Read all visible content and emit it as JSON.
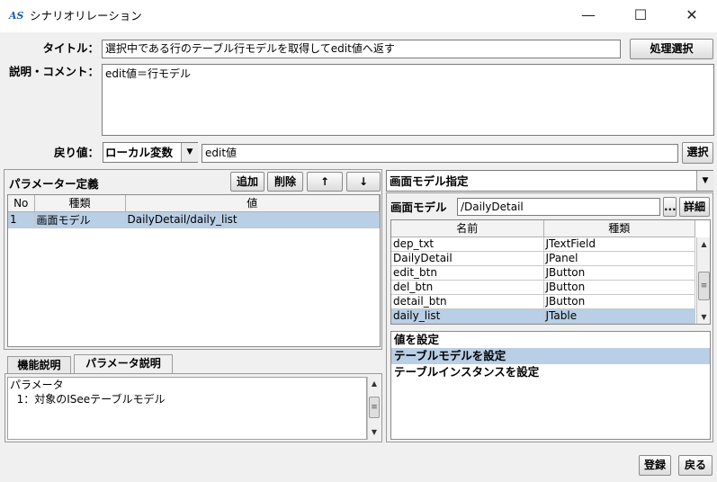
{
  "window": {
    "title": "シナリオリレーション",
    "logo": "AS",
    "minimize_icon": "minimize-icon",
    "maximize_icon": "maximize-icon",
    "close_icon": "close-icon"
  },
  "header": {
    "title_label": "タイトル：",
    "title_value": "選択中である行のテーブル行モデルを取得してedit値へ返す",
    "process_select_button": "処理選択",
    "comment_label": "説明・コメント：",
    "comment_value": "edit値＝行モデル",
    "return_label": "戻り値：",
    "return_scope": "ローカル変数",
    "return_value": "edit値",
    "return_select_button": "選択"
  },
  "params": {
    "heading": "パラメーター定義",
    "buttons": {
      "add": "追加",
      "delete": "削除",
      "up": "↑",
      "down": "↓"
    },
    "columns": [
      "No",
      "種類",
      "値"
    ],
    "rows": [
      {
        "no": "1",
        "kind": "画面モデル",
        "value": "DailyDetail/daily_list",
        "selected": true
      }
    ]
  },
  "tabs": {
    "items": [
      "機能説明",
      "パラメータ説明"
    ],
    "active_index": 1,
    "content_lines": [
      "パラメータ",
      "  1：対象のISeeテーブルモデル"
    ]
  },
  "screen_model": {
    "dropdown_value": "画面モデル指定",
    "model_label": "画面モデル",
    "model_value": "/DailyDetail",
    "ellipsis_button": "...",
    "detail_button": "詳細",
    "columns": [
      "名前",
      "種類"
    ],
    "rows": [
      {
        "name": "dep_txt",
        "type": "JTextField",
        "selected": false
      },
      {
        "name": "DailyDetail",
        "type": "JPanel",
        "selected": false
      },
      {
        "name": "edit_btn",
        "type": "JButton",
        "selected": false
      },
      {
        "name": "del_btn",
        "type": "JButton",
        "selected": false
      },
      {
        "name": "detail_btn",
        "type": "JButton",
        "selected": false
      },
      {
        "name": "daily_list",
        "type": "JTable",
        "selected": true
      }
    ],
    "action_list": [
      {
        "label": "値を設定",
        "selected": false
      },
      {
        "label": "テーブルモデルを設定",
        "selected": true
      },
      {
        "label": "テーブルインスタンスを設定",
        "selected": false
      }
    ]
  },
  "footer": {
    "register_button": "登録",
    "back_button": "戻る"
  },
  "colors": {
    "selection": "#b8cfe5",
    "background": "#f0f0f0",
    "logo": "#1e5fa8"
  }
}
